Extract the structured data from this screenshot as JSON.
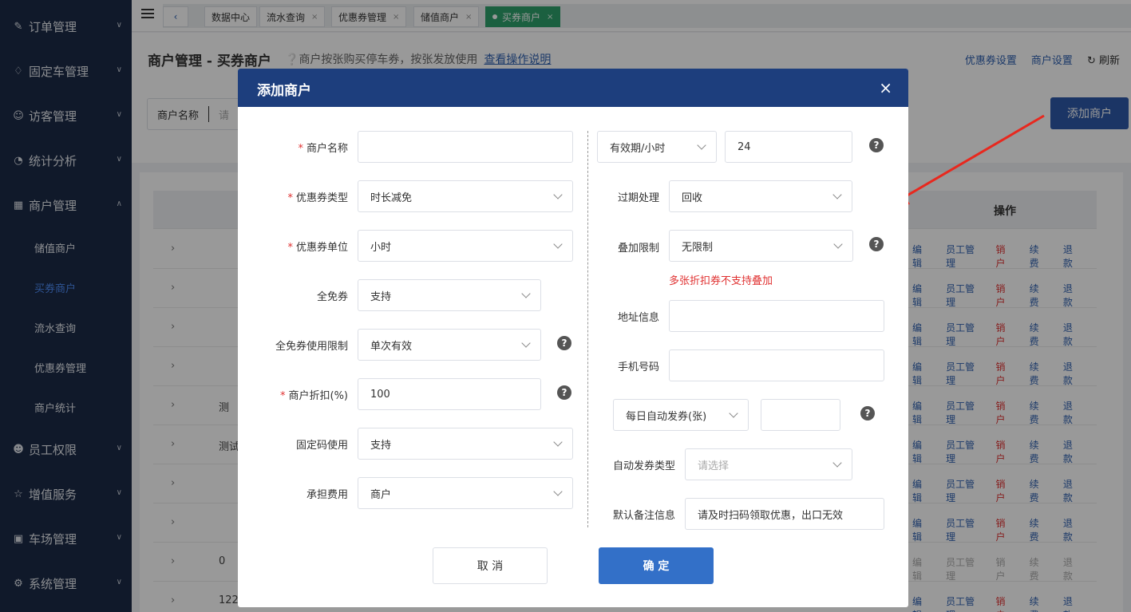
{
  "sidebar": {
    "menus": [
      {
        "label": "订单管理",
        "icon": "edit-icon"
      },
      {
        "label": "固定车管理",
        "icon": "diamond-icon"
      },
      {
        "label": "访客管理",
        "icon": "visitor-icon"
      },
      {
        "label": "统计分析",
        "icon": "pie-chart-icon"
      },
      {
        "label": "商户管理",
        "icon": "building-icon",
        "expanded": true
      },
      {
        "label": "员工权限",
        "icon": "user-key-icon"
      },
      {
        "label": "增值服务",
        "icon": "star-icon"
      },
      {
        "label": "车场管理",
        "icon": "parking-icon"
      },
      {
        "label": "系统管理",
        "icon": "settings-icon"
      }
    ],
    "sub_items": [
      {
        "label": "储值商户"
      },
      {
        "label": "买券商户",
        "active": true
      },
      {
        "label": "流水查询"
      },
      {
        "label": "优惠券管理"
      },
      {
        "label": "商户统计"
      }
    ]
  },
  "tabs": [
    {
      "label": "数据中心"
    },
    {
      "label": "流水查询",
      "closable": true
    },
    {
      "label": "优惠券管理",
      "closable": true
    },
    {
      "label": "储值商户",
      "closable": true
    },
    {
      "label": "买券商户",
      "closable": true,
      "active": true
    }
  ],
  "header": {
    "title": "商户管理 - 买券商户",
    "hint": "商户按张购买停车券，按张发放使用",
    "help_link": "查看操作说明",
    "coupon_settings": "优惠券设置",
    "merchant_settings": "商户设置",
    "refresh": "刷新"
  },
  "search": {
    "label": "商户名称",
    "placeholder": "请"
  },
  "add_merchant_button": "添加商户",
  "table": {
    "operation_header": "操作",
    "ops": {
      "edit": "编辑",
      "staff": "员工管理",
      "cancel": "销户",
      "renew": "续费",
      "refund": "退款"
    },
    "rows": [
      {
        "name": ""
      },
      {
        "name": ""
      },
      {
        "name": ""
      },
      {
        "name": ""
      },
      {
        "name": "测"
      },
      {
        "name": "测试"
      },
      {
        "name": ""
      },
      {
        "name": ""
      },
      {
        "name": "0",
        "disabled": true
      },
      {
        "name": "122"
      }
    ]
  },
  "dialog": {
    "title": "添加商户",
    "close": "×",
    "left": {
      "merchant_name": {
        "label": "商户名称",
        "required": true,
        "value": ""
      },
      "coupon_type": {
        "label": "优惠券类型",
        "required": true,
        "value": "时长减免"
      },
      "coupon_unit": {
        "label": "优惠券单位",
        "required": true,
        "value": "小时"
      },
      "free_coupon": {
        "label": "全免券",
        "value": "支持"
      },
      "free_coupon_limit": {
        "label": "全免券使用限制",
        "value": "单次有效"
      },
      "discount": {
        "label": "商户折扣(%)",
        "required": true,
        "value": "100"
      },
      "fixed_code": {
        "label": "固定码使用",
        "value": "支持"
      },
      "cost_bearer": {
        "label": "承担费用",
        "value": "商户"
      }
    },
    "right": {
      "validity_unit": {
        "value": "有效期/小时"
      },
      "validity_value": {
        "value": "24"
      },
      "expiry": {
        "label": "过期处理",
        "value": "回收"
      },
      "stack_limit": {
        "label": "叠加限制",
        "value": "无限制"
      },
      "stack_warning": "多张折扣券不支持叠加",
      "address": {
        "label": "地址信息",
        "value": ""
      },
      "phone": {
        "label": "手机号码",
        "value": ""
      },
      "daily_auto": {
        "value": "每日自动发券(张)"
      },
      "daily_auto_count": {
        "value": ""
      },
      "auto_type": {
        "label": "自动发券类型",
        "placeholder": "请选择"
      },
      "remark": {
        "label": "默认备注信息",
        "value": "请及时扫码领取优惠，出口无效"
      }
    },
    "cancel_button": "取 消",
    "ok_button": "确 定"
  },
  "colors": {
    "sidebar_bg": "#1b2a47",
    "dialog_header": "#1d3e7d",
    "primary": "#3370c8",
    "active_tab": "#2ea06c",
    "danger": "#e03131",
    "link": "#2d5fb0"
  }
}
